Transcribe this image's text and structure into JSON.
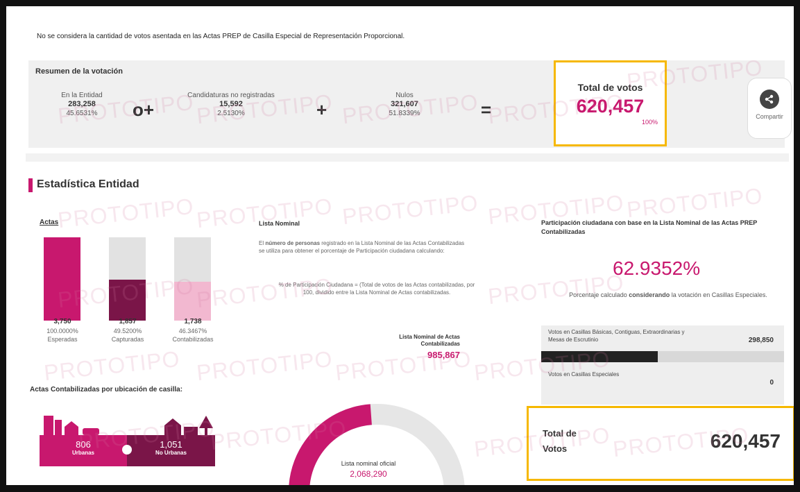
{
  "notice": "No se considera la cantidad de votos asentada en las Actas PREP de Casilla Especial de Representación Proporcional.",
  "summary": {
    "title": "Resumen de la votación",
    "items": [
      {
        "label": "En la Entidad",
        "value": "283,258",
        "pct": "45.6531%"
      },
      {
        "label": "Candidaturas no registradas",
        "value": "15,592",
        "pct": "2.5130%"
      },
      {
        "label": "Nulos",
        "value": "321,607",
        "pct": "51.8339%"
      }
    ],
    "ops": [
      "o+",
      "+",
      "="
    ],
    "total_label": "Total de votos",
    "total_value": "620,457",
    "total_pct": "100%"
  },
  "share": {
    "label": "Compartir",
    "icon": "share-icon"
  },
  "watermark": "PROTOTIPO",
  "section_title": "Estadística Entidad",
  "actas": {
    "title": "Actas",
    "bars": [
      {
        "value": "3,750",
        "pct": "100.0000%",
        "label": "Esperadas",
        "fill": 1.0,
        "color": "#c8186e"
      },
      {
        "value": "1,857",
        "pct": "49.5200%",
        "label": "Capturadas",
        "fill": 0.495,
        "color": "#7a1548"
      },
      {
        "value": "1,738",
        "pct": "46.3467%",
        "label": "Contabilizadas",
        "fill": 0.463,
        "color": "#f2b8d0"
      }
    ]
  },
  "lista_nominal": {
    "title": "Lista Nominal",
    "text_bold": "número de personas",
    "text_pre": "El ",
    "text_post": " registrado en la Lista Nominal de las Actas Contabilizadas se utiliza para obtener el porcentaje de Participación ciudadana calculando:",
    "formula": "% de Participación Ciudadana = (Total de votos de las Actas contabilizadas, por 100, dividido entre la Lista Nominal de Actas contabilizadas.",
    "actas_label": "Lista Nominal de Actas Contabilizadas",
    "actas_value": "985,867",
    "oficial_label": "Lista nominal oficial",
    "oficial_value": "2,068,290",
    "gauge_fraction": 0.4767
  },
  "participacion": {
    "title": "Participación ciudadana con base en la Lista Nominal de las Actas PREP Contabilizadas",
    "value": "62.9352%",
    "desc_pre": "Porcentaje calculado ",
    "desc_bold": "considerando",
    "desc_post": " la votación en Casillas Especiales.",
    "rows": [
      {
        "label": "Votos en Casillas Básicas, Contiguas, Extraordinarias y Mesas de Escrutinio",
        "value": "298,850",
        "fill": 0.48
      },
      {
        "label": "Votos en Casillas Especiales",
        "value": "0",
        "fill": 0
      }
    ]
  },
  "total_votos": {
    "label": "Total de Votos",
    "value": "620,457"
  },
  "ubicacion": {
    "title": "Actas Contabilizadas por ubicación de casilla:",
    "cards": [
      {
        "value": "806",
        "label": "Urbanas",
        "color": "#c8186e"
      },
      {
        "value": "1,051",
        "label": "No Urbanas",
        "color": "#7a1548"
      }
    ]
  }
}
